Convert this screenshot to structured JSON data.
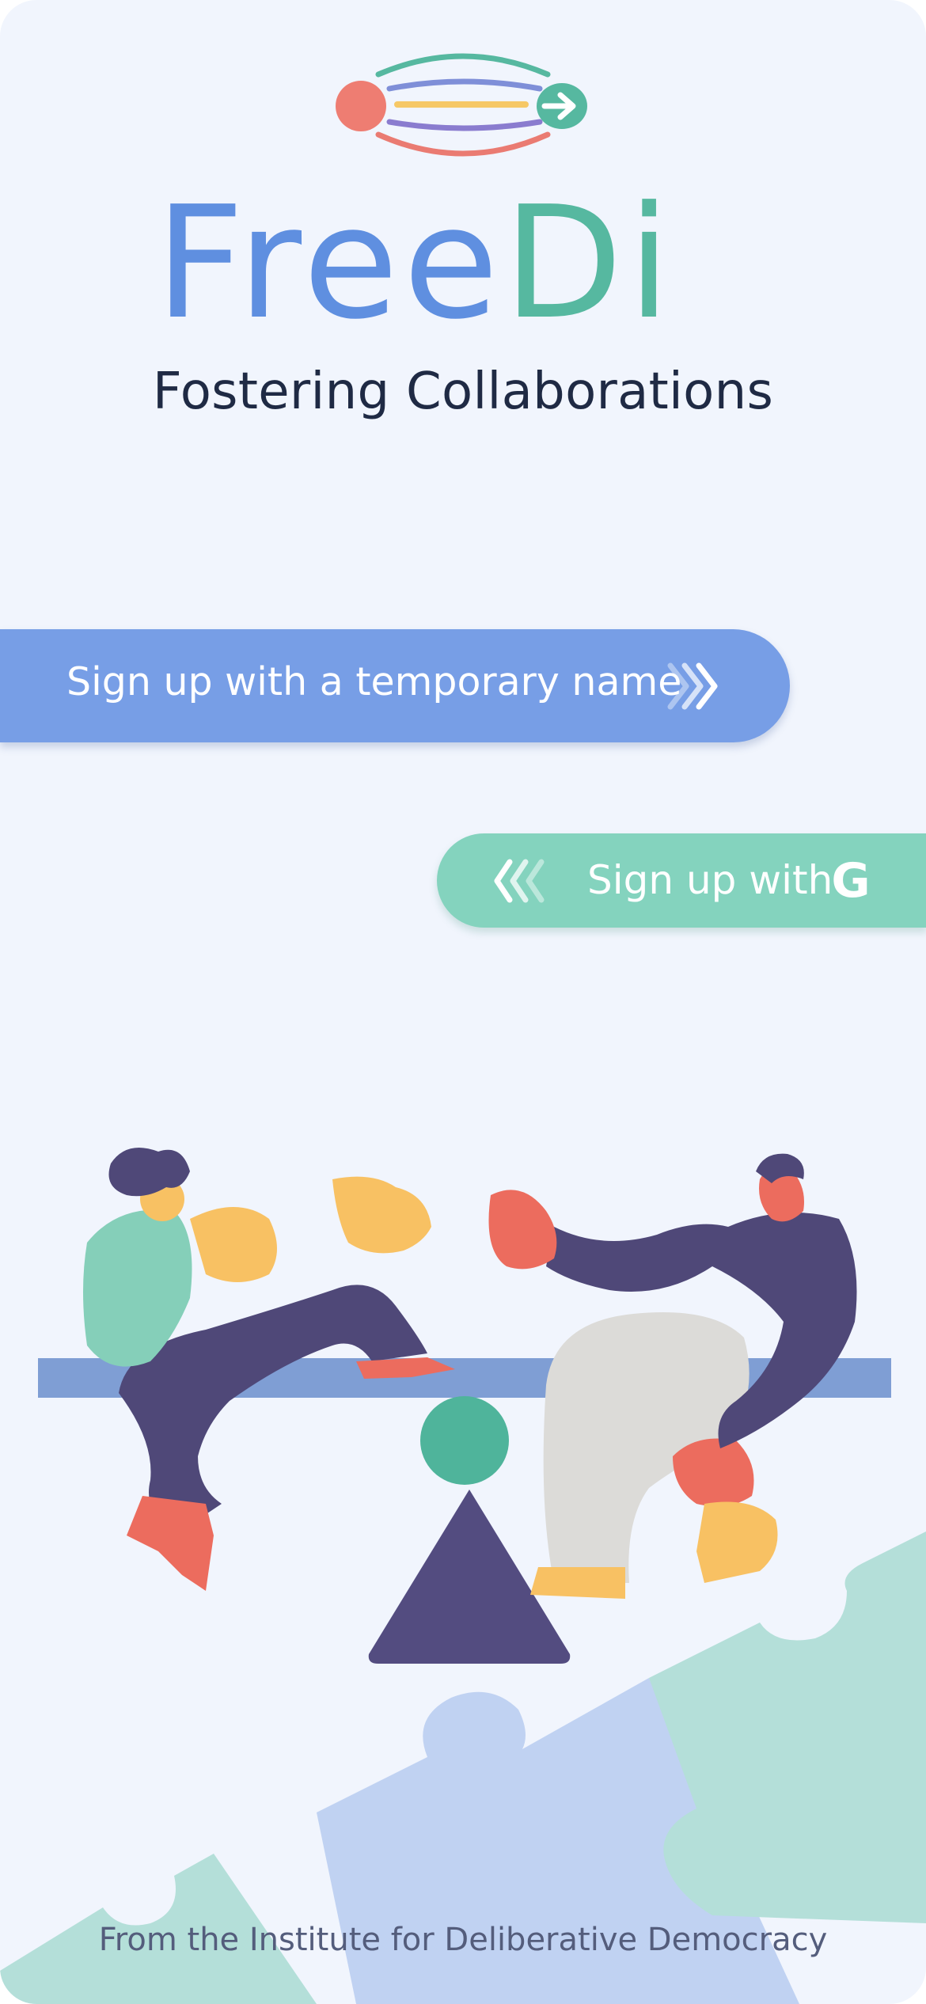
{
  "app": {
    "name": "FreeDi",
    "name_part_1": "Free",
    "name_part_2": "Di",
    "tagline": "Fostering Collaborations"
  },
  "actions": {
    "temporary_signup_label": "Sign up with a temporary name",
    "google_signup_label": "Sign up with",
    "google_logo_letter": "G"
  },
  "footer": {
    "credit": "From the Institute for Deliberative Democracy"
  },
  "icons": {
    "logo_mark": "freedi-logo-icon",
    "forward_chevrons": "triple-chevron-right-icon",
    "back_chevrons": "triple-chevron-left-icon",
    "google": "google-icon"
  },
  "colors": {
    "background": "#f1f5fd",
    "brand_blue": "#5f8fe0",
    "brand_green": "#56b8a0",
    "temp_button": "#779ee6",
    "google_button": "#84d3be",
    "tagline_text": "#1f2a44",
    "footer_text": "#545d7c"
  }
}
